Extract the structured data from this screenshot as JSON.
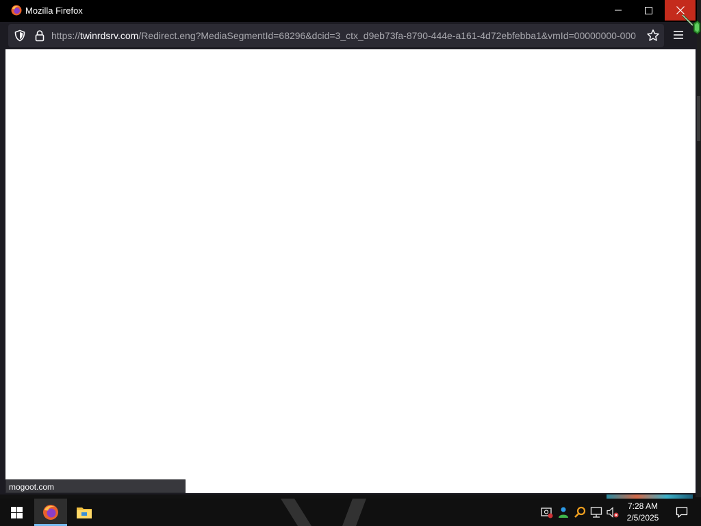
{
  "window": {
    "title": "Mozilla Firefox",
    "controls": [
      "minimize",
      "maximize",
      "close"
    ]
  },
  "navbar": {
    "url_host": "twinrdsrv.com",
    "url_path": "/Redirect.eng?MediaSegmentId=68296&dcid=3_ctx_d9eb73fa-8790-444e-a161-4d72ebfebba1&vmId=00000000-000",
    "url_scheme": "https://",
    "icons": [
      "shield-icon",
      "lock-icon",
      "star-icon",
      "menu-icon"
    ]
  },
  "status_bar": {
    "text": "mogoot.com"
  },
  "taskbar": {
    "apps": [
      "start-windows-icon",
      "firefox-icon",
      "file-explorer-icon"
    ],
    "tray_icons": [
      "security-icon",
      "people-icon",
      "search-icon",
      "network-icon",
      "volume-muted-icon"
    ],
    "clock_time": "7:28 AM",
    "clock_date": "2/5/2025"
  },
  "colors": {
    "titlebar": "#000000",
    "close_hover": "#c42b1c",
    "urlbar_bg": "#2b2a33",
    "page_bg": "#ffffff",
    "taskbar": "#101010"
  }
}
